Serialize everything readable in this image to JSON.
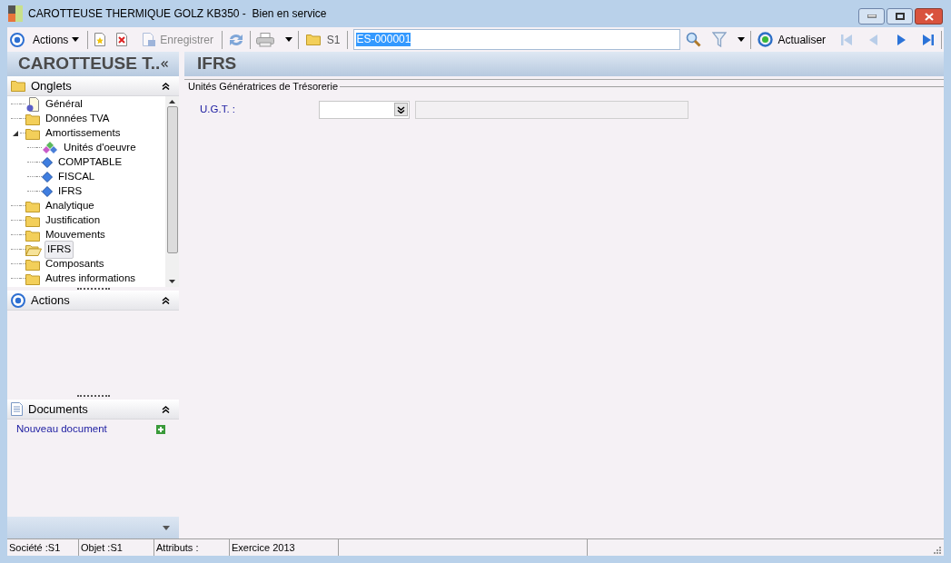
{
  "window": {
    "title": "CAROTTEUSE THERMIQUE GOLZ KB350 -  Bien en service"
  },
  "toolbar": {
    "actions_label": "Actions",
    "save_label": "Enregistrer",
    "save_disabled": true,
    "folder_label": "S1",
    "search_value": "ES-000001",
    "refresh_label": "Actualiser",
    "nav": [
      {
        "kind": "first",
        "disabled": true
      },
      {
        "kind": "prev",
        "disabled": true
      },
      {
        "kind": "next",
        "disabled": false
      },
      {
        "kind": "last",
        "disabled": false
      }
    ]
  },
  "sidebar": {
    "title": "CAROTTEUSE T..",
    "tabs_panel": {
      "title": "Onglets",
      "items": [
        {
          "label": "Général",
          "kind": "page",
          "selected": false
        },
        {
          "label": "Données TVA",
          "kind": "folder",
          "selected": false
        },
        {
          "label": "Amortissements",
          "kind": "folder",
          "selected": false,
          "expanded": true,
          "children": [
            {
              "label": "Unités d'oeuvre",
              "kind": "units",
              "selected": false
            },
            {
              "label": "COMPTABLE",
              "kind": "diamond",
              "selected": false
            },
            {
              "label": "FISCAL",
              "kind": "diamond",
              "selected": false
            },
            {
              "label": "IFRS",
              "kind": "diamond",
              "selected": false
            }
          ]
        },
        {
          "label": "Analytique",
          "kind": "folder",
          "selected": false
        },
        {
          "label": "Justification",
          "kind": "folder",
          "selected": false
        },
        {
          "label": "Mouvements",
          "kind": "folder",
          "selected": false
        },
        {
          "label": "IFRS",
          "kind": "folder",
          "selected": true
        },
        {
          "label": "Composants",
          "kind": "folder",
          "selected": false
        },
        {
          "label": "Autres informations",
          "kind": "folder",
          "selected": false
        }
      ]
    },
    "actions_panel": {
      "title": "Actions"
    },
    "documents_panel": {
      "title": "Documents",
      "link": "Nouveau document"
    }
  },
  "content": {
    "title": "IFRS",
    "group_title": "Unités Génératrices de Trésorerie",
    "fields": [
      {
        "label": "U.G.T. :"
      }
    ]
  },
  "status_bar": [
    "Société :S1",
    "Objet :S1",
    "Attributs :",
    "Exercice 2013"
  ]
}
